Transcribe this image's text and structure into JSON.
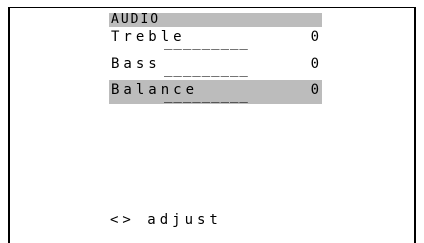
{
  "menu": {
    "title": "AUDIO",
    "items": [
      {
        "label": "Treble",
        "bar": "_________",
        "value": "0",
        "selected": false
      },
      {
        "label": "Bass",
        "bar": "_________",
        "value": "0",
        "selected": false
      },
      {
        "label": "Balance",
        "bar": "_________",
        "value": "0",
        "selected": true
      }
    ]
  },
  "footer": {
    "hint": "<> adjust"
  },
  "colors": {
    "highlight": "#bcbcbc",
    "background": "#ffffff",
    "text": "#000000"
  }
}
